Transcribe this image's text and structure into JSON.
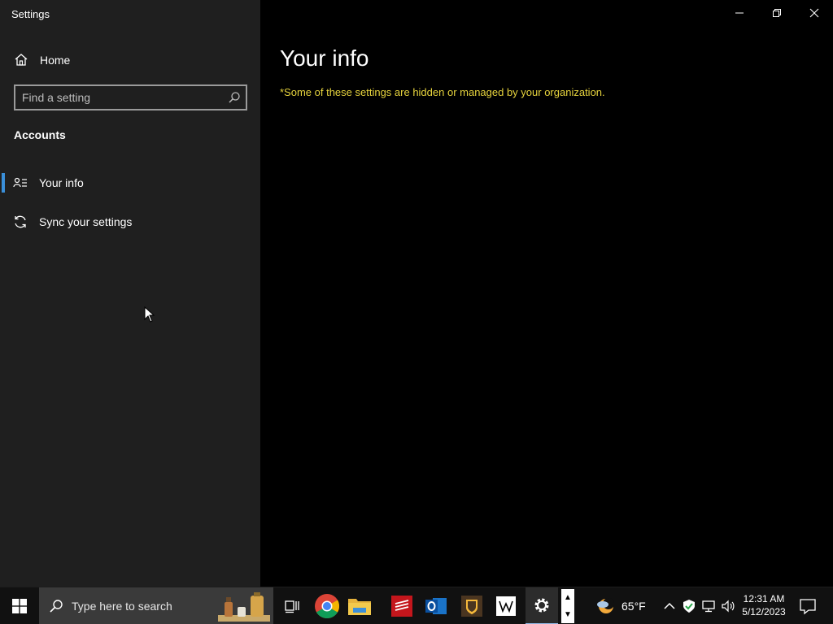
{
  "window": {
    "title": "Settings",
    "controls": [
      "minimize",
      "restore",
      "close"
    ]
  },
  "sidebar": {
    "home_label": "Home",
    "search_placeholder": "Find a setting",
    "section_title": "Accounts",
    "items": [
      {
        "label": "Your info",
        "icon": "person-list-icon",
        "selected": true
      },
      {
        "label": "Sync your settings",
        "icon": "sync-icon",
        "selected": false
      }
    ]
  },
  "main": {
    "title": "Your info",
    "notice": "*Some of these settings are hidden or managed by your organization."
  },
  "colors": {
    "accent": "#3a8fd9",
    "notice": "#e6d33d",
    "sidebar_bg": "#1f1f1f",
    "main_bg": "#000000"
  },
  "taskbar": {
    "search_label": "Type here to search",
    "apps": [
      "task-view",
      "chrome",
      "file-explorer",
      "bank-app",
      "outlook",
      "ups",
      "wikipedia",
      "settings"
    ],
    "weather": {
      "temp": "65°F"
    },
    "clock": {
      "time": "12:31 AM",
      "date": "5/12/2023"
    }
  }
}
